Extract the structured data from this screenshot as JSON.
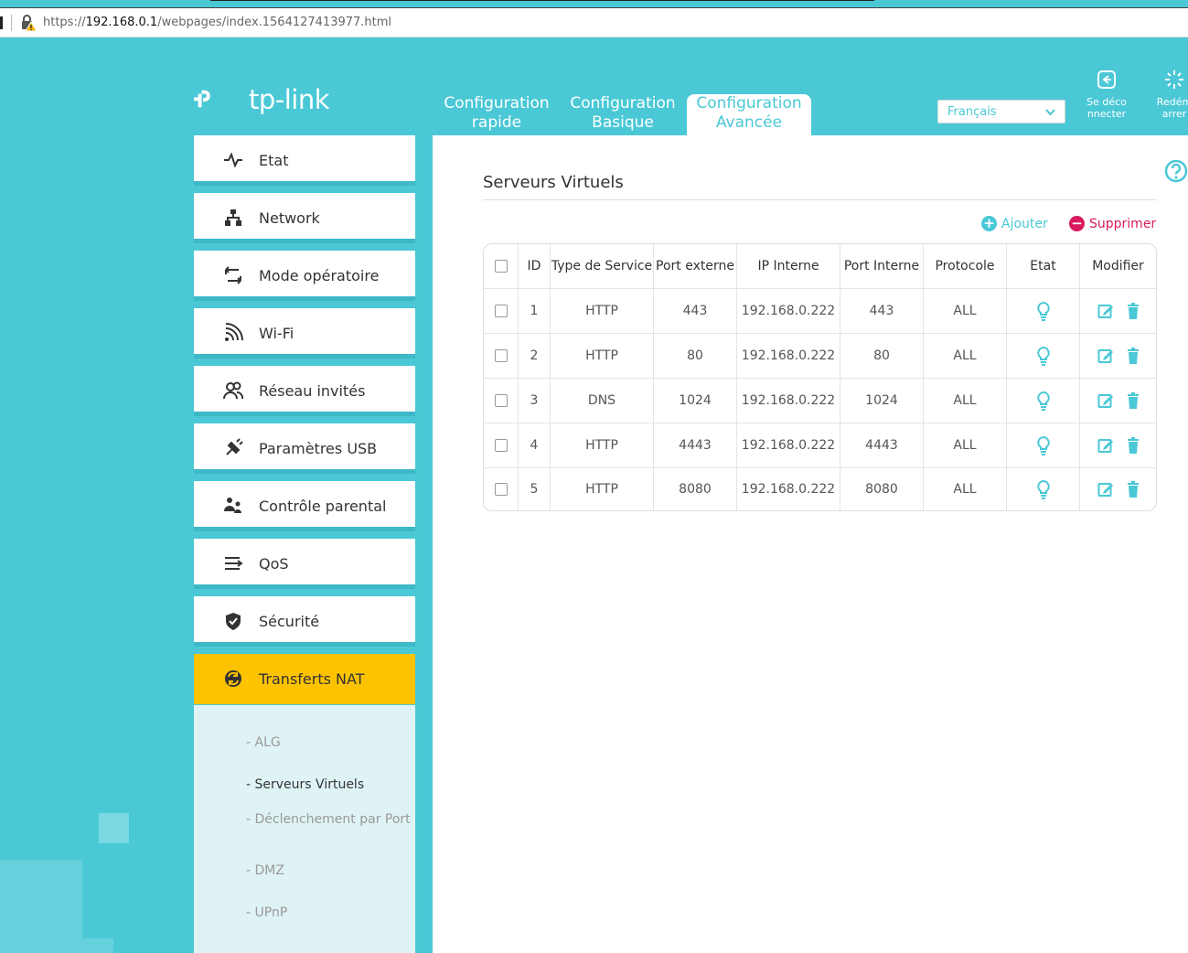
{
  "browser": {
    "url_prefix": "https://",
    "url_host": "192.168.0.1",
    "url_path": "/webpages/index.1564127413977.html"
  },
  "brand": {
    "logo_text": "tp-link"
  },
  "tabs": [
    {
      "line1": "Configuration",
      "line2": "rapide"
    },
    {
      "line1": "Configuration",
      "line2": "Basique"
    },
    {
      "line1": "Configuration",
      "line2": "Avancée"
    }
  ],
  "language": {
    "selected": "Français"
  },
  "top_actions": {
    "logout": "Se déco\nnnecter",
    "reboot": "Redém\narrer"
  },
  "sidebar": {
    "items": [
      {
        "label": "Etat",
        "icon": "pulse-icon"
      },
      {
        "label": "Network",
        "icon": "network-icon"
      },
      {
        "label": "Mode opératoire",
        "icon": "mode-switch-icon"
      },
      {
        "label": "Wi-Fi",
        "icon": "wifi-icon"
      },
      {
        "label": "Réseau invités",
        "icon": "guests-icon"
      },
      {
        "label": "Paramètres USB",
        "icon": "usb-icon"
      },
      {
        "label": "Contrôle parental",
        "icon": "parental-icon"
      },
      {
        "label": "QoS",
        "icon": "qos-icon"
      },
      {
        "label": "Sécurité",
        "icon": "shield-icon"
      },
      {
        "label": "Transferts NAT",
        "icon": "nat-icon"
      }
    ],
    "submenu": [
      {
        "label": "ALG"
      },
      {
        "label": "Serveurs Virtuels"
      },
      {
        "label": "Déclenchement par Port"
      },
      {
        "label": "DMZ"
      },
      {
        "label": "UPnP"
      }
    ]
  },
  "main": {
    "title": "Serveurs Virtuels",
    "add_label": "Ajouter",
    "delete_label": "Supprimer",
    "columns": [
      "ID",
      "Type de Service",
      "Port externe",
      "IP Interne",
      "Port Interne",
      "Protocole",
      "Etat",
      "Modifier"
    ],
    "rows": [
      {
        "id": "1",
        "type": "HTTP",
        "ext": "443",
        "ip": "192.168.0.222",
        "int": "443",
        "proto": "ALL"
      },
      {
        "id": "2",
        "type": "HTTP",
        "ext": "80",
        "ip": "192.168.0.222",
        "int": "80",
        "proto": "ALL"
      },
      {
        "id": "3",
        "type": "DNS",
        "ext": "1024",
        "ip": "192.168.0.222",
        "int": "1024",
        "proto": "ALL"
      },
      {
        "id": "4",
        "type": "HTTP",
        "ext": "4443",
        "ip": "192.168.0.222",
        "int": "4443",
        "proto": "ALL"
      },
      {
        "id": "5",
        "type": "HTTP",
        "ext": "8080",
        "ip": "192.168.0.222",
        "int": "8080",
        "proto": "ALL"
      }
    ]
  },
  "colors": {
    "brand": "#4ac8d6",
    "active_menu": "#fdc300",
    "delete": "#d81b60"
  }
}
